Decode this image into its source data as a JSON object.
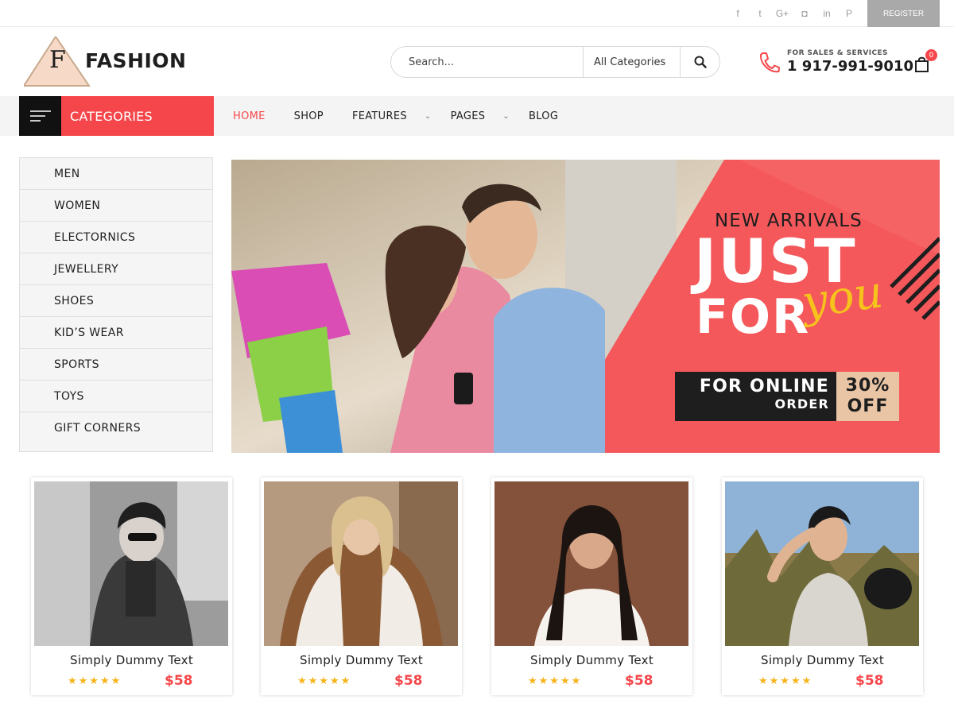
{
  "topbar": {
    "social": [
      {
        "name": "facebook",
        "glyph": "f"
      },
      {
        "name": "twitter",
        "glyph": "t"
      },
      {
        "name": "google-plus",
        "glyph": "G+"
      },
      {
        "name": "instagram",
        "glyph": "◘"
      },
      {
        "name": "linkedin",
        "glyph": "in"
      },
      {
        "name": "pinterest",
        "glyph": "P"
      }
    ],
    "register_label": "REGISTER"
  },
  "header": {
    "logo_letter": "F",
    "logo_text": "FASHION",
    "search": {
      "placeholder": "Search...",
      "category": "All Categories"
    },
    "phone_label": "FOR SALES & SERVICES",
    "phone_number": "1 917-991-9010",
    "cart_count": "0"
  },
  "nav": {
    "categories_label": "CATEGORIES",
    "menu": [
      "HOME",
      "SHOP",
      "FEATURES",
      "PAGES",
      "BLOG"
    ]
  },
  "sidebar": {
    "items": [
      "MEN",
      "WOMEN",
      "ELECTORNICS",
      "JEWELLERY",
      "SHOES",
      "KID’S WEAR",
      "SPORTS",
      "TOYS",
      "GIFT CORNERS"
    ]
  },
  "banner": {
    "kicker": "NEW ARRIVALS",
    "headline_1": "JUST",
    "headline_2": "FOR",
    "script_word": "you",
    "offer_line_1": "FOR ONLINE",
    "offer_line_2": "ORDER",
    "offer_pct": "30%",
    "offer_word": "OFF"
  },
  "products": [
    {
      "name": "Simply Dummy Text",
      "price": "$58",
      "rating": 5,
      "stars": "★★★★★"
    },
    {
      "name": "Simply Dummy Text",
      "price": "$58",
      "rating": 5,
      "stars": "★★★★★"
    },
    {
      "name": "Simply Dummy Text",
      "price": "$58",
      "rating": 5,
      "stars": "★★★★★"
    },
    {
      "name": "Simply Dummy Text",
      "price": "$58",
      "rating": 5,
      "stars": "★★★★★"
    }
  ],
  "colors": {
    "accent": "#f5474b",
    "star": "#f6b41c",
    "offer_tan": "#e9c5a6",
    "dark": "#1e1e1e"
  }
}
